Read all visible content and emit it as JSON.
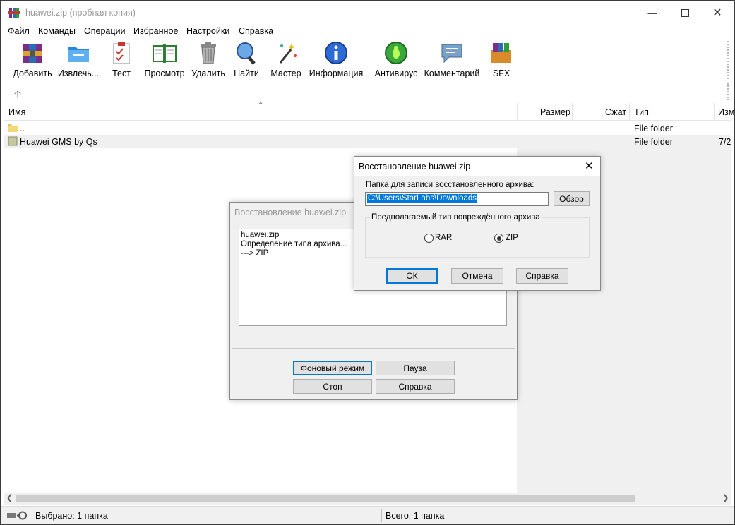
{
  "window": {
    "title": "huawei.zip (пробная копия)"
  },
  "menu": [
    "Файл",
    "Команды",
    "Операции",
    "Избранное",
    "Настройки",
    "Справка"
  ],
  "toolbar": {
    "add": "Добавить",
    "extract": "Извлечь...",
    "test": "Тест",
    "view": "Просмотр",
    "delete": "Удалить",
    "find": "Найти",
    "wizard": "Мастер",
    "info": "Информация",
    "antivirus": "Антивирус",
    "comment": "Комментарий",
    "sfx": "SFX"
  },
  "columns": {
    "name": "Имя",
    "size": "Размер",
    "packed": "Сжат",
    "type": "Тип",
    "modified": "Изм"
  },
  "rows": [
    {
      "name": "..",
      "type": "File folder",
      "modified": ""
    },
    {
      "name": "Huawei GMS by Qs",
      "type": "File folder",
      "modified": "7/2"
    }
  ],
  "status": {
    "selected": "Выбрано: 1 папка",
    "total": "Всего: 1 папка"
  },
  "progress_dialog": {
    "title": "Восстановление huawei.zip",
    "log": [
      "huawei.zip",
      "Определение типа архива...",
      "---> ZIP"
    ],
    "background_btn": "Фоновый режим",
    "pause_btn": "Пауза",
    "stop_btn": "Стоп",
    "help_btn": "Справка"
  },
  "repair_dialog": {
    "title": "Восстановление huawei.zip",
    "folder_label": "Папка для записи восстановленного архива:",
    "folder_value": "C:\\Users\\StarLabs\\Downloads",
    "browse_btn": "Обзор",
    "group_label": "Предполагаемый тип повреждённого архива",
    "option_rar": "RAR",
    "option_zip": "ZIP",
    "selected": "ZIP",
    "ok_btn": "ОК",
    "cancel_btn": "Отмена",
    "help_btn": "Справка"
  }
}
